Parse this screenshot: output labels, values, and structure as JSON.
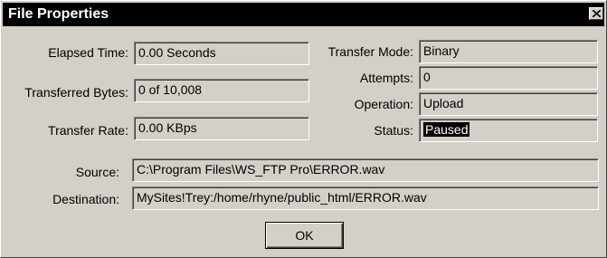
{
  "window": {
    "title": "File Properties"
  },
  "fields": {
    "elapsed_time": {
      "label": "Elapsed Time:",
      "value": "0.00 Seconds"
    },
    "transferred_bytes": {
      "label": "Transferred Bytes:",
      "value": "0 of 10,008"
    },
    "transfer_rate": {
      "label": "Transfer Rate:",
      "value": "0.00 KBps"
    },
    "transfer_mode": {
      "label": "Transfer Mode:",
      "value": "Binary"
    },
    "attempts": {
      "label": "Attempts:",
      "value": "0"
    },
    "operation": {
      "label": "Operation:",
      "value": "Upload"
    },
    "status": {
      "label": "Status:",
      "value": "Paused"
    },
    "source": {
      "label": "Source:",
      "value": "C:\\Program Files\\WS_FTP Pro\\ERROR.wav"
    },
    "destination": {
      "label": "Destination:",
      "value": "MySites!Trey:/home/rhyne/public_html/ERROR.wav"
    }
  },
  "buttons": {
    "ok_label": "OK"
  },
  "icons": {
    "close": "close-icon"
  },
  "colors": {
    "titlebar": "#000000",
    "dialog_bg": "#d4d0c8",
    "status_highlight": "#000000"
  }
}
